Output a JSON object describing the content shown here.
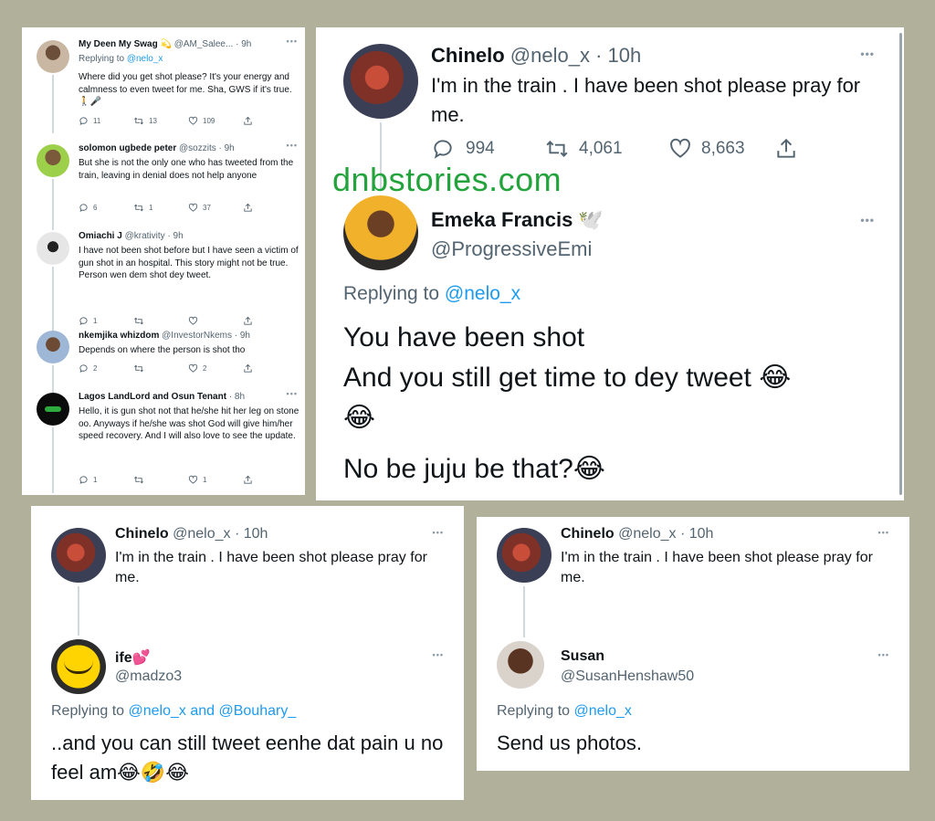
{
  "watermark": "dnbstories.com",
  "left_panel": {
    "tweets": [
      {
        "name": "My Deen My Swag 💫",
        "handle": "@AM_Salee...",
        "time": "· 9h",
        "replying_prefix": "Replying to",
        "replying_to": "@nelo_x",
        "text": "Where did you get shot please? It's your energy and calmness to even tweet for me. Sha, GWS if it's true. 🚶🎤",
        "replies": "11",
        "retweets": "13",
        "likes": "109"
      },
      {
        "name": "solomon ugbede peter",
        "handle": "@sozzits",
        "time": "· 9h",
        "text": "But she is not the only one who has tweeted from the train, leaving in denial does not help anyone",
        "replies": "6",
        "retweets": "1",
        "likes": "37"
      },
      {
        "name": "Omiachi J",
        "handle": "@krativity",
        "time": "· 9h",
        "text": "I have not been shot before but I have seen a victim of gun shot in an hospital. This story might not be true. Person wen dem shot dey tweet.",
        "replies": "1",
        "retweets": "",
        "likes": ""
      },
      {
        "name": "nkemjika whizdom",
        "handle": "@InvestorNkems",
        "time": "· 9h",
        "text": "Depends on where the person is shot tho",
        "replies": "2",
        "retweets": "",
        "likes": "2"
      },
      {
        "name": "Lagos LandLord and Osun Tenant",
        "handle": "",
        "time": "· 8h",
        "text": "Hello, it is gun shot not that he/she hit her leg on stone oo. Anyways if he/she was shot God will give him/her speed recovery. And I will also love to see the update.",
        "replies": "1",
        "retweets": "",
        "likes": "1"
      }
    ]
  },
  "main_panel": {
    "original": {
      "name": "Chinelo",
      "handle": "@nelo_x",
      "time": "· 10h",
      "text": "I'm in the train .  I have been shot please pray for me.",
      "replies": "994",
      "retweets": "4,061",
      "likes": "8,663"
    },
    "reply": {
      "name": "Emeka Francis 🕊️",
      "handle": "@ProgressiveEmi",
      "replying_prefix": "Replying to",
      "replying_to": "@nelo_x",
      "line1": "You have been shot",
      "line2": "And you still get time to dey tweet 😂",
      "line3": "😂",
      "line4": "No be juju be that?😂"
    }
  },
  "bottom_left_panel": {
    "original": {
      "name": "Chinelo",
      "handle": "@nelo_x",
      "time": "· 10h",
      "text": "I'm in the train .  I have been shot please pray for me."
    },
    "reply": {
      "name": "ife💕",
      "handle": "@madzo3",
      "replying_prefix": "Replying to",
      "replying_to": "@nelo_x and @Bouhary_",
      "text": "..and you can still tweet eenhe dat pain u no feel am😂🤣😂"
    }
  },
  "bottom_right_panel": {
    "original": {
      "name": "Chinelo",
      "handle": "@nelo_x",
      "time": "· 10h",
      "text": "I'm in the train .  I have been shot please pray for me."
    },
    "reply": {
      "name": "Susan",
      "handle": "@SusanHenshaw50",
      "replying_prefix": "Replying to",
      "replying_to": "@nelo_x",
      "text": "Send us photos."
    }
  },
  "icons": {
    "reply": "reply-bubble-icon",
    "retweet": "retweet-icon",
    "like": "heart-icon",
    "share": "share-icon",
    "more": "more-dots-icon"
  },
  "colors": {
    "background": "#b1b09a",
    "link": "#1d9bf0",
    "watermark": "#22a33b",
    "muted": "#536471"
  }
}
